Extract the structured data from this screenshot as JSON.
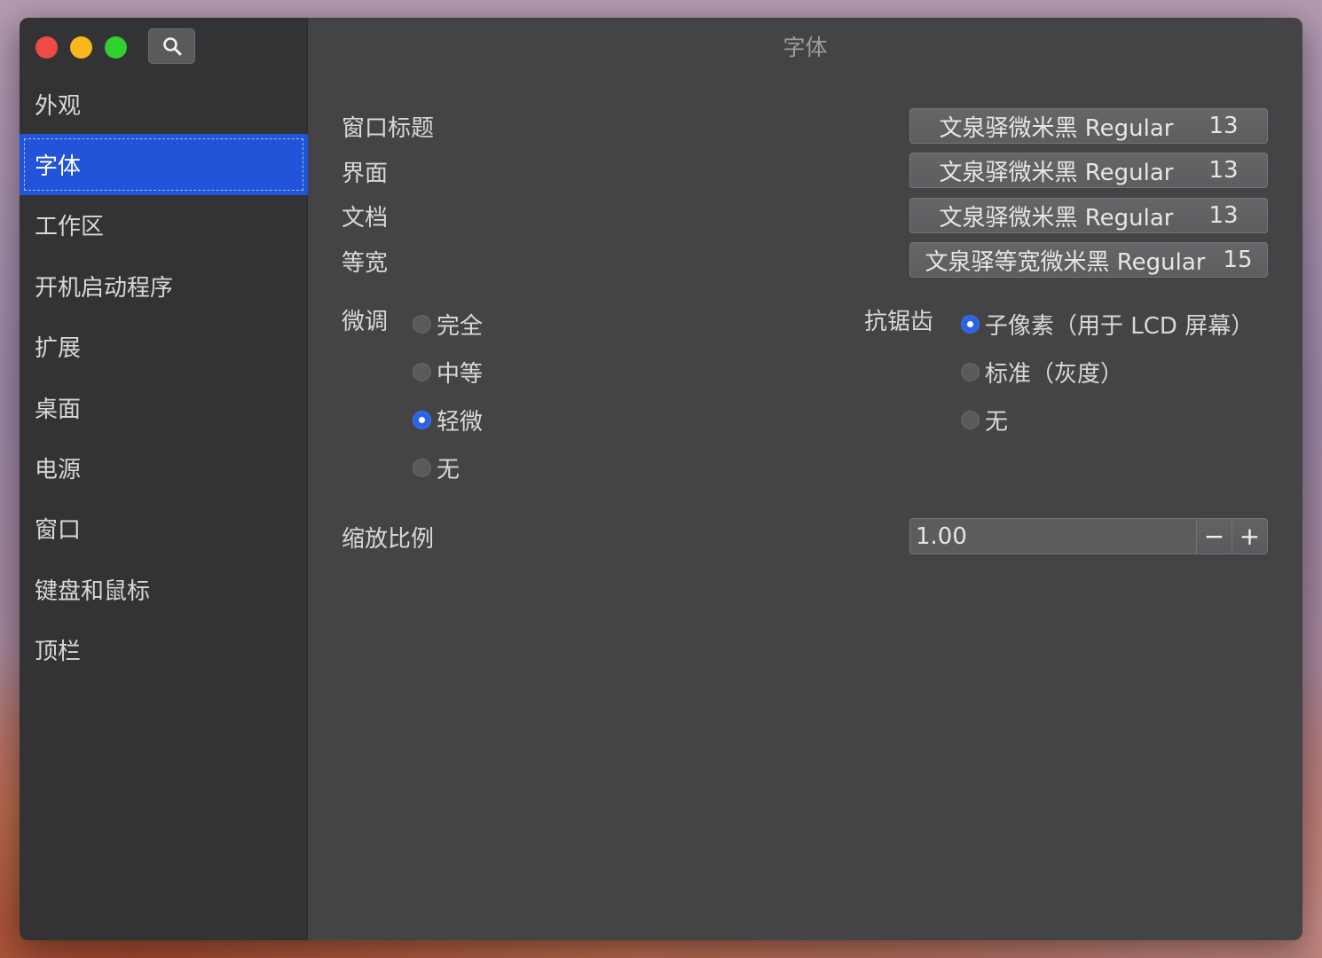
{
  "window": {
    "title": "字体"
  },
  "sidebar": {
    "items": [
      {
        "label": "外观"
      },
      {
        "label": "字体",
        "active": true
      },
      {
        "label": "工作区"
      },
      {
        "label": "开机启动程序"
      },
      {
        "label": "扩展"
      },
      {
        "label": "桌面"
      },
      {
        "label": "电源"
      },
      {
        "label": "窗口"
      },
      {
        "label": "键盘和鼠标"
      },
      {
        "label": "顶栏"
      }
    ]
  },
  "fonts": [
    {
      "label": "窗口标题",
      "font": "文泉驿微米黑 Regular",
      "size": "13"
    },
    {
      "label": "界面",
      "font": "文泉驿微米黑 Regular",
      "size": "13"
    },
    {
      "label": "文档",
      "font": "文泉驿微米黑 Regular",
      "size": "13"
    },
    {
      "label": "等宽",
      "font": "文泉驿等宽微米黑 Regular",
      "size": "15"
    }
  ],
  "hinting": {
    "label": "微调",
    "options": [
      "完全",
      "中等",
      "轻微",
      "无"
    ],
    "selected": "轻微"
  },
  "antialiasing": {
    "label": "抗锯齿",
    "options": [
      "子像素（用于 LCD 屏幕）",
      "标准（灰度）",
      "无"
    ],
    "selected": "子像素（用于 LCD 屏幕）"
  },
  "scaling": {
    "label": "缩放比例",
    "value": "1.00",
    "minus": "−",
    "plus": "+"
  },
  "colors": {
    "accent": "#2154d9",
    "sidebar_bg": "#333335",
    "main_bg": "#444446"
  }
}
